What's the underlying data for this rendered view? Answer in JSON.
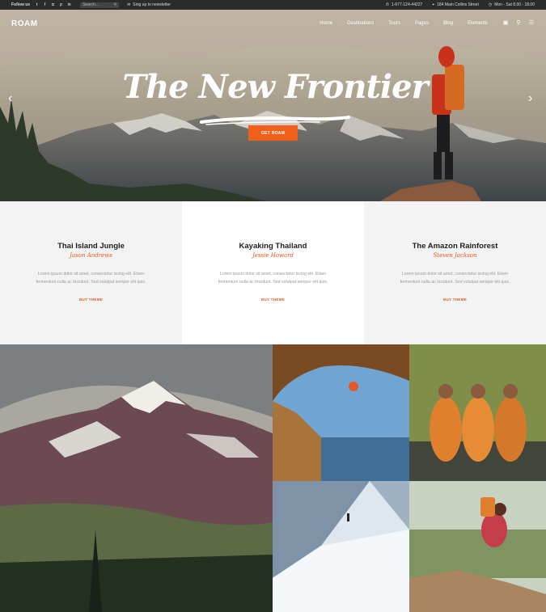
{
  "topbar": {
    "follow_label": "Follow us",
    "social_icons": [
      "twitter-icon",
      "facebook-icon",
      "instagram-icon",
      "pinterest-icon",
      "linkedin-icon"
    ],
    "search_placeholder": "Search...",
    "newsletter_label": "Sing up to newsletter",
    "phone": "1-677-124-44227",
    "address": "184 Main Collins Street",
    "hours": "Mon - Sat 8.00 - 18.00"
  },
  "nav": {
    "logo": "ROAM",
    "items": [
      "Home",
      "Destinations",
      "Tours",
      "Pages",
      "Blog",
      "Elements"
    ]
  },
  "hero": {
    "title": "The New Frontier",
    "button": "GET ROAM"
  },
  "cards": [
    {
      "title": "Thai Island Jungle",
      "author": "Jason Andrews",
      "text": "Lorem ipsum dolor sit amet, consectetur iscing elit. Etiam fermentum nulla ac tincidunt. Sed volutpat semper elit quis.",
      "link": "BUY THEME"
    },
    {
      "title": "Kayaking Thailand",
      "author": "Jessie Howard",
      "text": "Lorem ipsum dolor sit amet, consectetur iscing elit. Etiam fermentum nulla ac tincidunt. Sed volutpat semper elit quis.",
      "link": "BUY THEME"
    },
    {
      "title": "The Amazon Rainforest",
      "author": "Steven Jackson",
      "text": "Lorem ipsum dolor sit amet, consectetur iscing elit. Etiam fermentum nulla ac tincidunt. Sed volutpat semper elit quis.",
      "link": "BUY THEME"
    }
  ],
  "colors": {
    "accent": "#f0601a",
    "topbar": "#2b2b2b"
  }
}
